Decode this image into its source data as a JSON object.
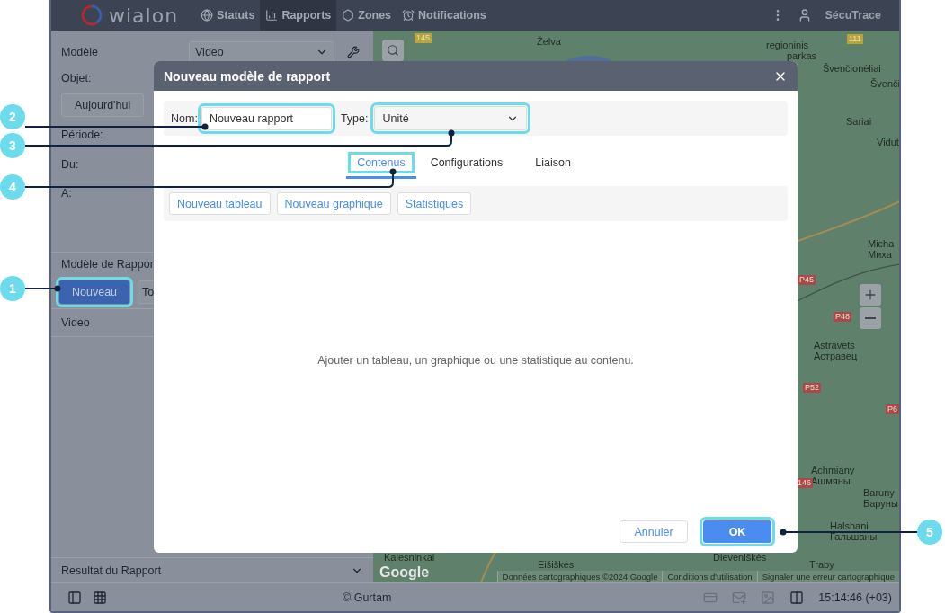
{
  "header": {
    "logo_text": "wialon",
    "nav": [
      {
        "label": "Statuts",
        "selected": false
      },
      {
        "label": "Rapports",
        "selected": true
      },
      {
        "label": "Zones",
        "selected": false
      },
      {
        "label": "Notifications",
        "selected": false
      }
    ],
    "user": "SécuTrace"
  },
  "sidebar": {
    "template_label": "Modèle",
    "template_value": "Video",
    "object_label": "Objet:",
    "today_button": "Aujourd'hui",
    "period_label": "Période:",
    "from_label": "Du:",
    "to_label": "A:",
    "templates_title": "Modèle de Rappor",
    "new_button": {
      "label": "Nouveau",
      "highlighted": true
    },
    "second_button": "To",
    "templates": [
      {
        "name": "Video"
      }
    ],
    "result_title": "Resultat du Rapport"
  },
  "map": {
    "labels": [
      {
        "text": "Želva"
      },
      {
        "text": "regioninis"
      },
      {
        "text": "parkas"
      },
      {
        "text": "Švenčionėliai"
      },
      {
        "text": "Švenči"
      },
      {
        "text": "Sariai"
      },
      {
        "text": "Vidut"
      },
      {
        "text": "Micha"
      },
      {
        "text": "Миха"
      },
      {
        "text": "Astravets"
      },
      {
        "text": "Астравец"
      },
      {
        "text": "Achmiany"
      },
      {
        "text": "Ашмяны"
      },
      {
        "text": "Baruny"
      },
      {
        "text": "Баруны"
      },
      {
        "text": "Halshani"
      },
      {
        "text": "Гальшаны"
      },
      {
        "text": "Kalesninkai"
      },
      {
        "text": "Eišiškės"
      },
      {
        "text": "Dieveniškės"
      },
      {
        "text": "Traby"
      }
    ],
    "road_numbers": [
      {
        "text": "145",
        "color": "#b9a43a"
      },
      {
        "text": "111",
        "color": "#b9a43a"
      },
      {
        "text": "P45",
        "color": "#a8494c"
      },
      {
        "text": "P48",
        "color": "#a8494c"
      },
      {
        "text": "P52",
        "color": "#a8494c"
      },
      {
        "text": "P6",
        "color": "#a8494c"
      },
      {
        "text": "146",
        "color": "#a8494c"
      }
    ],
    "logo": "Google",
    "attribution": [
      "Données cartographiques ©2024 Google",
      "Conditions d'utilisation",
      "Signaler une erreur cartographique"
    ]
  },
  "dialog": {
    "title": "Nouveau modèle de rapport",
    "name_label": "Nom:",
    "name_value": "Nouveau rapport",
    "name_highlighted": true,
    "type_label": "Type:",
    "type_value": "Unité",
    "type_highlighted": true,
    "tabs": [
      {
        "label": "Contenus",
        "selected": true,
        "highlighted": true
      },
      {
        "label": "Configurations",
        "selected": false,
        "highlighted": false
      },
      {
        "label": "Liaison",
        "selected": false,
        "highlighted": false
      }
    ],
    "tools": [
      "Nouveau tableau",
      "Nouveau graphique",
      "Statistiques"
    ],
    "empty_message": "Ajouter un tableau, un graphique ou une statistique au contenu.",
    "cancel": "Annuler",
    "ok": {
      "label": "OK",
      "highlighted": true
    }
  },
  "footer": {
    "copyright": "© Gurtam",
    "time": "15:14:46 (+03)"
  },
  "callouts": [
    {
      "number": "2"
    },
    {
      "number": "3"
    },
    {
      "number": "4"
    },
    {
      "number": "1"
    },
    {
      "number": "5"
    }
  ]
}
